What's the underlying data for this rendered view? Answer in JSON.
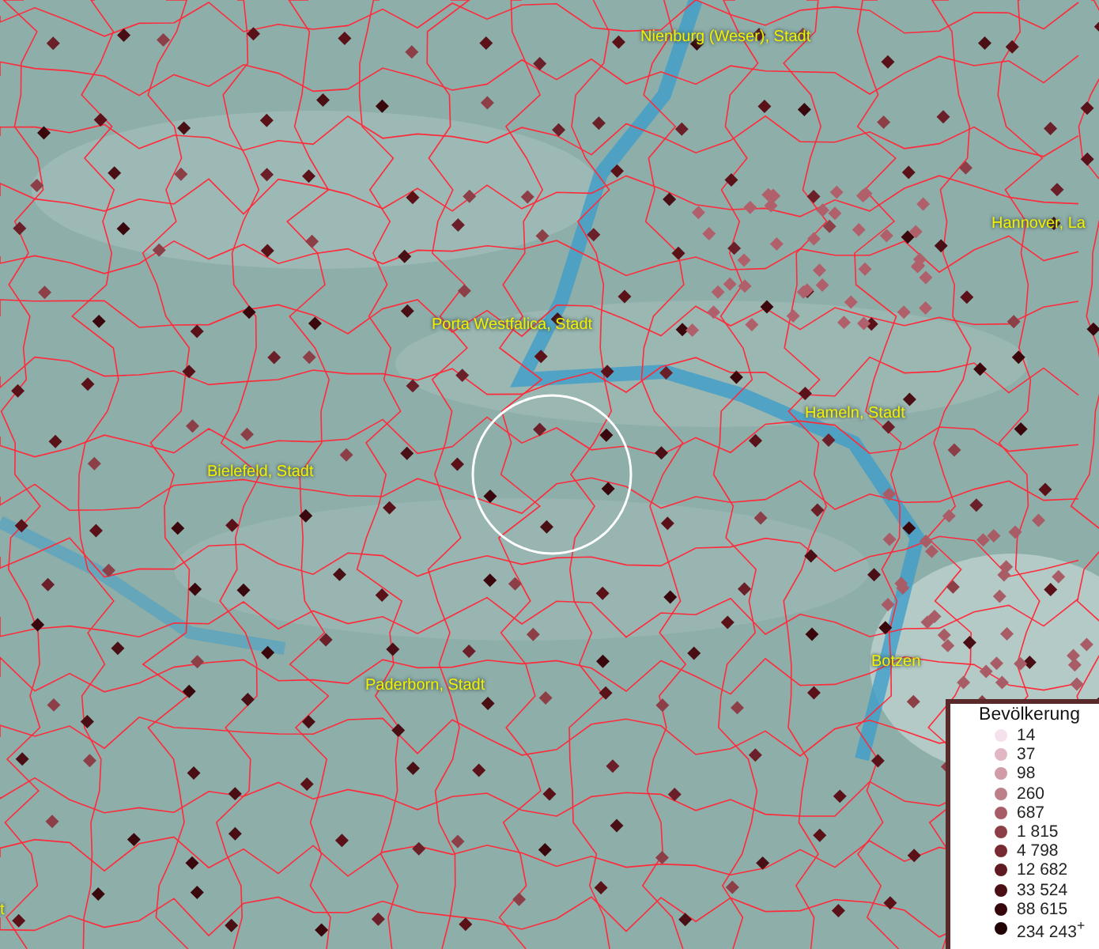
{
  "map": {
    "place_labels": [
      "Nienburg (Weser), Stadt",
      "Hannover, La",
      "Porta Westfalica, Stadt",
      "Hameln, Stadt",
      "Bielefeld, Stadt",
      "Botzen",
      "Paderborn, Stadt",
      "t"
    ]
  },
  "legend": {
    "title": "Bevölkerung",
    "items": [
      {
        "label": "14",
        "color": "#f5e1ec"
      },
      {
        "label": "37",
        "color": "#e2b7c4"
      },
      {
        "label": "98",
        "color": "#cf9ca7"
      },
      {
        "label": "260",
        "color": "#bd7f8a"
      },
      {
        "label": "687",
        "color": "#a65d67"
      },
      {
        "label": "1 815",
        "color": "#8d3f48"
      },
      {
        "label": "4 798",
        "color": "#782a33"
      },
      {
        "label": "12 682",
        "color": "#5f1a22"
      },
      {
        "label": "33 524",
        "color": "#4a0f15"
      },
      {
        "label": "88 615",
        "color": "#35070c"
      },
      {
        "label": "234 243$^{+}$",
        "color": "#210306"
      }
    ]
  }
}
